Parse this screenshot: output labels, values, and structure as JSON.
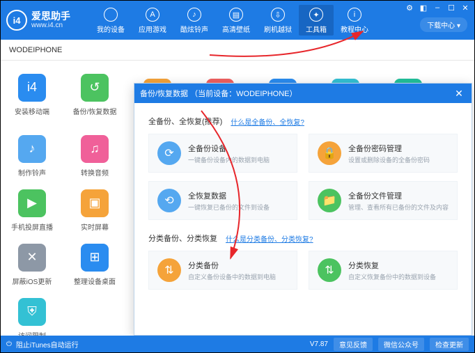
{
  "header": {
    "logo_text": "i4",
    "title": "爱思助手",
    "url": "www.i4.cn",
    "download_center": "下载中心 ▾",
    "nav": [
      {
        "label": "我的设备",
        "glyph": ""
      },
      {
        "label": "应用游戏",
        "glyph": "A"
      },
      {
        "label": "酷炫铃声",
        "glyph": "♪"
      },
      {
        "label": "高清壁纸",
        "glyph": "▤"
      },
      {
        "label": "刷机越狱",
        "glyph": "⇩"
      },
      {
        "label": "工具箱",
        "glyph": "✦"
      },
      {
        "label": "教程中心",
        "glyph": "i"
      }
    ]
  },
  "tab_row": {
    "device_name": "WODEIPHONE"
  },
  "tools_row1": [
    {
      "label": "安装移动端",
      "color": "bg-blue",
      "glyph": "i4"
    },
    {
      "label": "备份/恢复数据",
      "color": "bg-green",
      "glyph": "↺"
    },
    {
      "label": "",
      "color": "bg-orange",
      "glyph": "▧"
    },
    {
      "label": "",
      "color": "bg-red",
      "glyph": "ID"
    },
    {
      "label": "",
      "color": "bg-blue",
      "glyph": "⬇"
    },
    {
      "label": "",
      "color": "bg-cyan",
      "glyph": "A"
    },
    {
      "label": "",
      "color": "bg-teal",
      "glyph": "◧"
    }
  ],
  "tools_left": [
    {
      "label": "制作铃声",
      "color": "bg-lblue",
      "glyph": "♪"
    },
    {
      "label": "转换音频",
      "color": "bg-pink",
      "glyph": "♫"
    },
    {
      "label": "手机投屏直播",
      "color": "bg-green",
      "glyph": "▶"
    },
    {
      "label": "实时屏幕",
      "color": "bg-orange",
      "glyph": "▣"
    },
    {
      "label": "屏蔽iOS更新",
      "color": "bg-gray",
      "glyph": "✕"
    },
    {
      "label": "整理设备桌面",
      "color": "bg-blue",
      "glyph": "⊞"
    },
    {
      "label": "访问限制",
      "color": "bg-cyan",
      "glyph": "⛨"
    }
  ],
  "dialog": {
    "title_prefix": "备份/恢复数据",
    "title_device": "（当前设备：WODEIPHONE）",
    "section1_label": "全备份、全恢复(推荐)",
    "section1_help": "什么是全备份、全恢复?",
    "cards1": [
      {
        "title": "全备份设备",
        "sub": "一键备份设备内的数据到电脑",
        "color": "bg-lblue",
        "glyph": "⟳"
      },
      {
        "title": "全备份密码管理",
        "sub": "设置或删除设备的全备份密码",
        "color": "bg-orange",
        "glyph": "🔒"
      },
      {
        "title": "全恢复数据",
        "sub": "一键恢复已备份的文件到设备",
        "color": "bg-lblue",
        "glyph": "⟲"
      },
      {
        "title": "全备份文件管理",
        "sub": "管理、查看所有已备份的文件及内容",
        "color": "bg-green",
        "glyph": "📁"
      }
    ],
    "section2_label": "分类备份、分类恢复",
    "section2_help": "什么是分类备份、分类恢复?",
    "cards2": [
      {
        "title": "分类备份",
        "sub": "自定义备份设备中的数据到电脑",
        "color": "bg-orange",
        "glyph": "⇅"
      },
      {
        "title": "分类恢复",
        "sub": "自定义恢复备份中的数据到设备",
        "color": "bg-green",
        "glyph": "⇅"
      }
    ]
  },
  "status": {
    "left_label": "阻止iTunes自动运行",
    "version": "V7.87",
    "btn1": "意见反馈",
    "btn2": "微信公众号",
    "btn3": "检查更新"
  }
}
